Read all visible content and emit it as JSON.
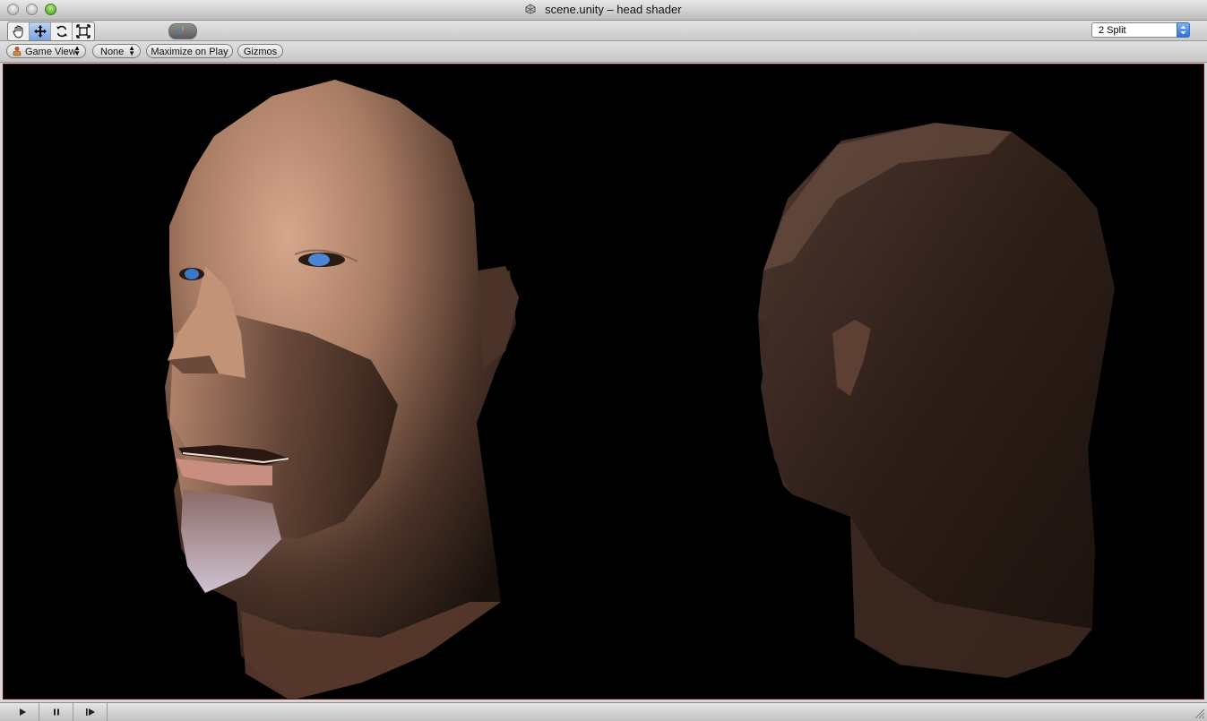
{
  "window": {
    "title": "scene.unity –   head shader",
    "title_icon": "unity-icon"
  },
  "toolbar": {
    "tools": [
      {
        "name": "hand-tool",
        "icon": "hand-icon",
        "active": false
      },
      {
        "name": "move-tool",
        "icon": "move-icon",
        "active": true
      },
      {
        "name": "rotate-tool",
        "icon": "rotate-icon",
        "active": false
      },
      {
        "name": "scale-tool",
        "icon": "scale-icon",
        "active": false
      }
    ],
    "pivot_icon": "pivot-gizmo-icon",
    "layout_value": "2 Split"
  },
  "view_controls": {
    "view_type": "Game View",
    "aspect": "None",
    "maximize_label": "Maximize on Play",
    "gizmos_label": "Gizmos"
  },
  "viewport": {
    "background": "#000000",
    "content": "Two shaded 3D head models"
  },
  "playbar": {
    "buttons": [
      "play-icon",
      "pause-icon",
      "step-icon"
    ]
  },
  "colors": {
    "accent_blue": "#3a7be0",
    "skin": "#b78a73"
  }
}
